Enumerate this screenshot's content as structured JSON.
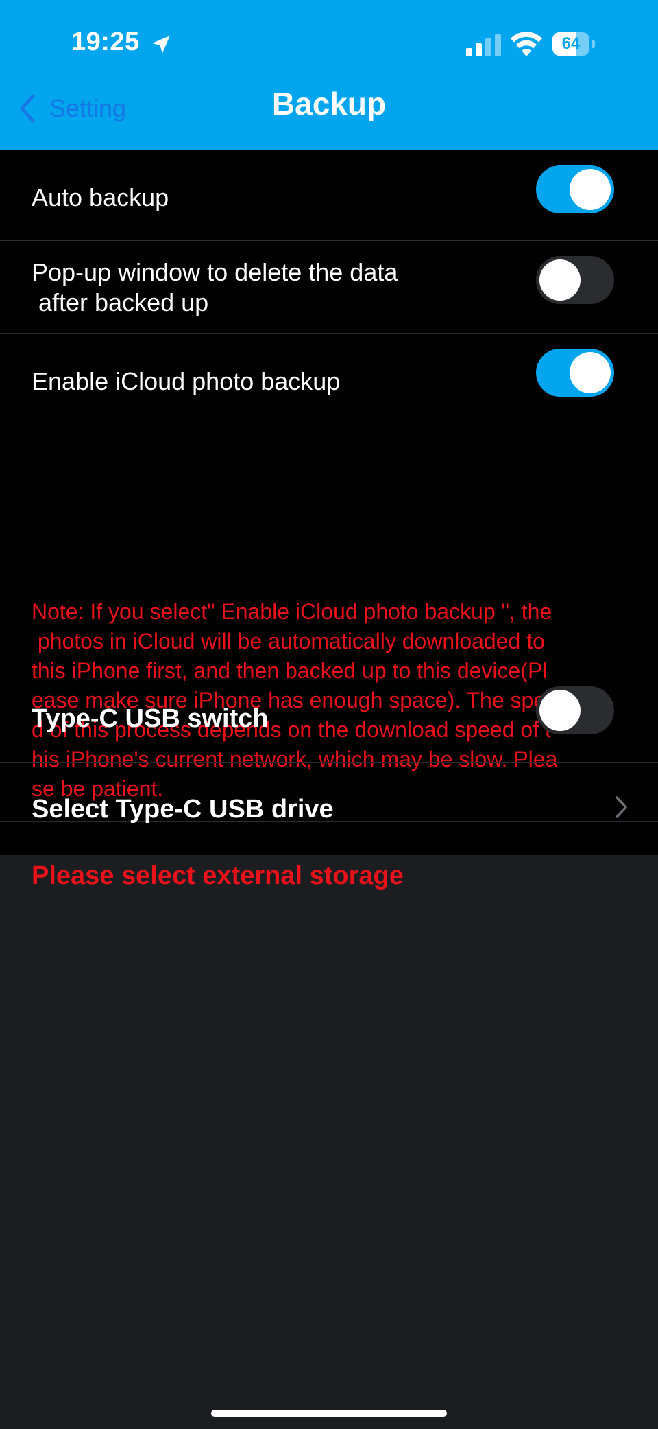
{
  "status_bar": {
    "time": "19:25",
    "battery": "64",
    "battery_level": 0.64
  },
  "nav": {
    "back_label": "Setting",
    "title": "Backup"
  },
  "settings": [
    {
      "label": "Auto backup",
      "on": true
    },
    {
      "label": "Pop-up window to delete the data\n after backed up",
      "on": false
    },
    {
      "label": "Enable iCloud photo backup",
      "on": true
    },
    {
      "label": "Type-C USB switch",
      "on": false
    },
    {
      "label": "Select Type-C USB drive"
    }
  ],
  "note": "Note: If you select\" Enable iCloud photo backup \", the\n photos in iCloud will be automatically downloaded to\nthis iPhone first, and then backed up to this device(Pl\nease make sure iPhone has enough space). The spee\nd of this process depends on the download speed of t\nhis iPhone's current network, which may be slow. Plea\nse be patient.",
  "storage_warning": "Please select external storage",
  "colors": {
    "accent": "#03a6ee",
    "warning": "#e8121b",
    "back_link": "#1578e6"
  }
}
